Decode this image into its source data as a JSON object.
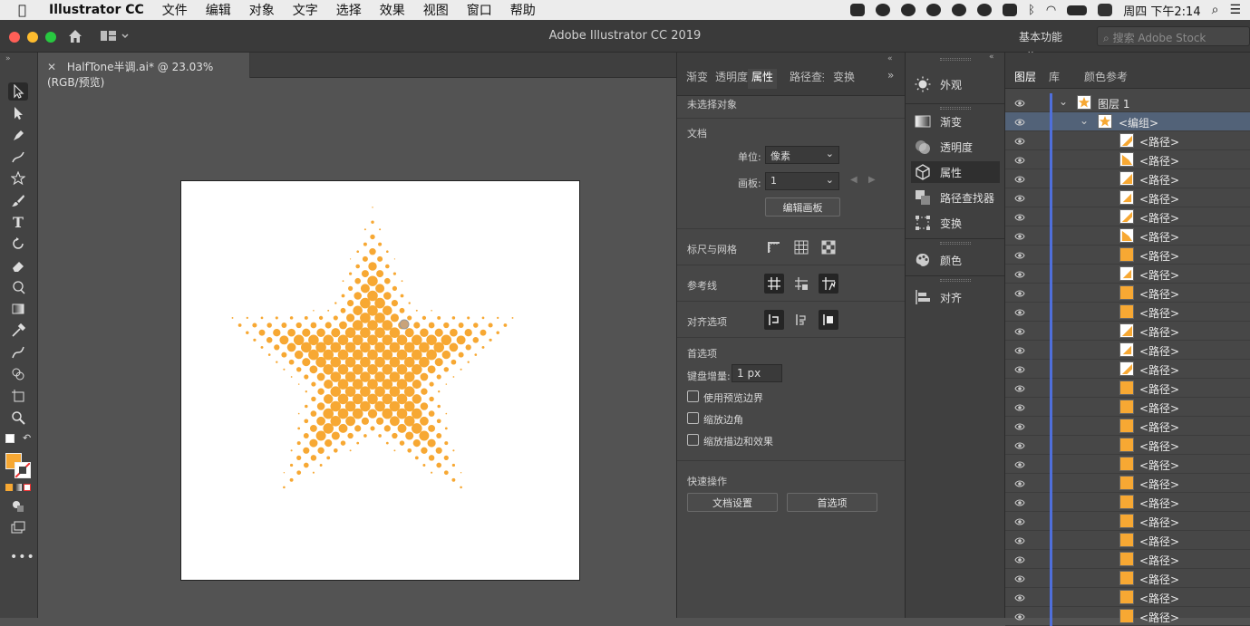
{
  "menubar": {
    "app_name": "Illustrator CC",
    "items": [
      "文件",
      "编辑",
      "对象",
      "文字",
      "选择",
      "效果",
      "视图",
      "窗口",
      "帮助"
    ],
    "clock": "周四 下午2:14"
  },
  "window": {
    "title": "Adobe Illustrator CC 2019",
    "workspace": "基本功能",
    "search_placeholder": "搜索 Adobe Stock"
  },
  "document": {
    "tab_label": "HalfTone半调.ai* @ 23.03% (RGB/预览)"
  },
  "colors": {
    "dot_orange": "#f7a833",
    "accent_blue": "#4f6fdb",
    "fill_swatch": "#f7a833"
  },
  "properties": {
    "tabs": [
      "渐变",
      "透明度",
      "属性",
      "路径查找",
      "变换"
    ],
    "active_tab": "属性",
    "no_selection": "未选择对象",
    "doc_section": "文档",
    "unit_label": "单位:",
    "unit_value": "像素",
    "artboard_label": "画板:",
    "artboard_value": "1",
    "edit_artboard_button": "编辑画板",
    "rulers_grid": "标尺与网格",
    "guides": "参考线",
    "align_options": "对齐选项",
    "prefs_section": "首选项",
    "keyboard_increment_label": "键盘增量:",
    "keyboard_increment_value": "1 px",
    "checkbox_preview_bounds": "使用预览边界",
    "checkbox_scale_corners": "缩放边角",
    "checkbox_scale_strokes": "缩放描边和效果",
    "quick_actions": "快速操作",
    "doc_settings_button": "文档设置",
    "prefs_button": "首选项"
  },
  "dock": {
    "items": [
      "外观",
      "渐变",
      "透明度",
      "属性",
      "路径查找器",
      "变换",
      "颜色",
      "对齐"
    ],
    "active": "属性"
  },
  "layers": {
    "tabs": [
      "图层",
      "库",
      "颜色参考"
    ],
    "active_tab": "图层",
    "layer_name": "图层 1",
    "group_name": "<编组>",
    "path_name": "<路径>",
    "path_count": 26
  }
}
